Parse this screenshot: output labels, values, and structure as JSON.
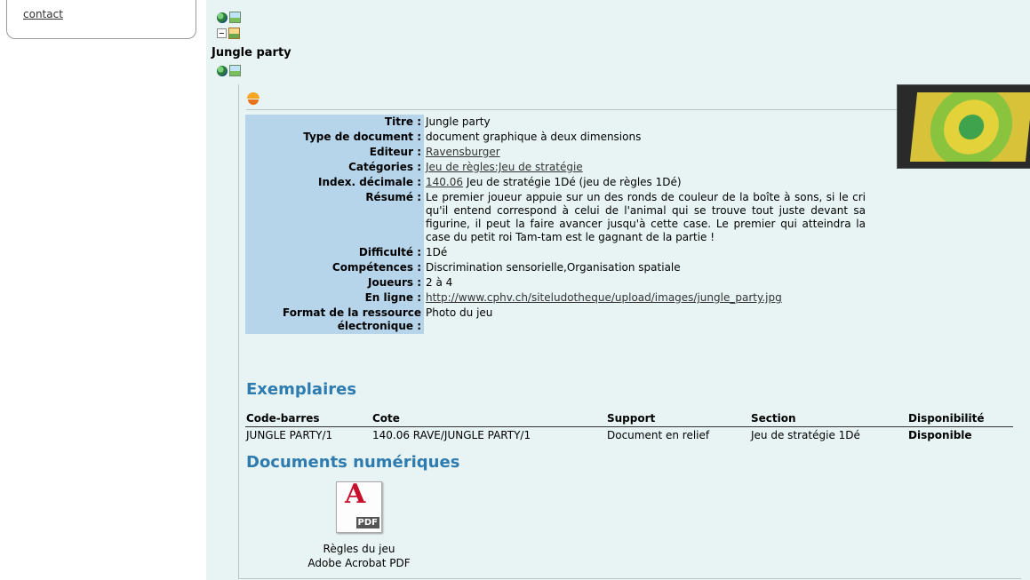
{
  "sidebar": {
    "contact": "contact"
  },
  "notice": {
    "title": "Jungle party",
    "fields": [
      {
        "label": "Titre :",
        "value": "Jungle party"
      },
      {
        "label": "Type de document :",
        "value": "document graphique à deux dimensions"
      },
      {
        "label": "Editeur :",
        "value": "Ravensburger"
      },
      {
        "label": "Catégories :",
        "value": "Jeu de règles:Jeu de stratégie"
      },
      {
        "label": "Index. décimale :",
        "link": "140.06",
        "value": " Jeu de stratégie 1Dé (jeu de règles 1Dé)"
      },
      {
        "label": "Résumé :",
        "value": "Le premier joueur appuie sur un des ronds de couleur de la boîte à sons, si le cri qu'il entend correspond à celui de l'animal qui se trouve tout juste devant sa figurine, il peut la faire avancer jusqu'à cette case. Le premier qui atteindra la case du petit roi Tam-tam est le gagnant de la partie !"
      },
      {
        "label": "Difficulté :",
        "value": "1Dé"
      },
      {
        "label": "Compétences :",
        "value": "Discrimination sensorielle,Organisation spatiale"
      },
      {
        "label": "Joueurs :",
        "value": "2 à 4"
      },
      {
        "label": "En ligne :",
        "value": "http://www.cphv.ch/siteludotheque/upload/images/jungle_party.jpg"
      },
      {
        "label": "Format de la ressource électronique :",
        "value": "Photo du jeu"
      }
    ]
  },
  "exemplaires": {
    "title": "Exemplaires",
    "headers": [
      "Code-barres",
      "Cote",
      "Support",
      "Section",
      "Disponibilité"
    ],
    "rows": [
      [
        "JUNGLE PARTY/1",
        "140.06 RAVE/JUNGLE PARTY/1",
        "Document en relief",
        "Jeu de stratégie 1Dé",
        "Disponible"
      ]
    ]
  },
  "documents": {
    "title": "Documents numériques",
    "item_name": "Règles du jeu",
    "item_type": "Adobe Acrobat PDF",
    "badge": "PDF"
  },
  "colors": {
    "accent": "#2e7bb0",
    "label_bg": "#b6d5ea",
    "panel_bg": "#e8f4f4"
  }
}
